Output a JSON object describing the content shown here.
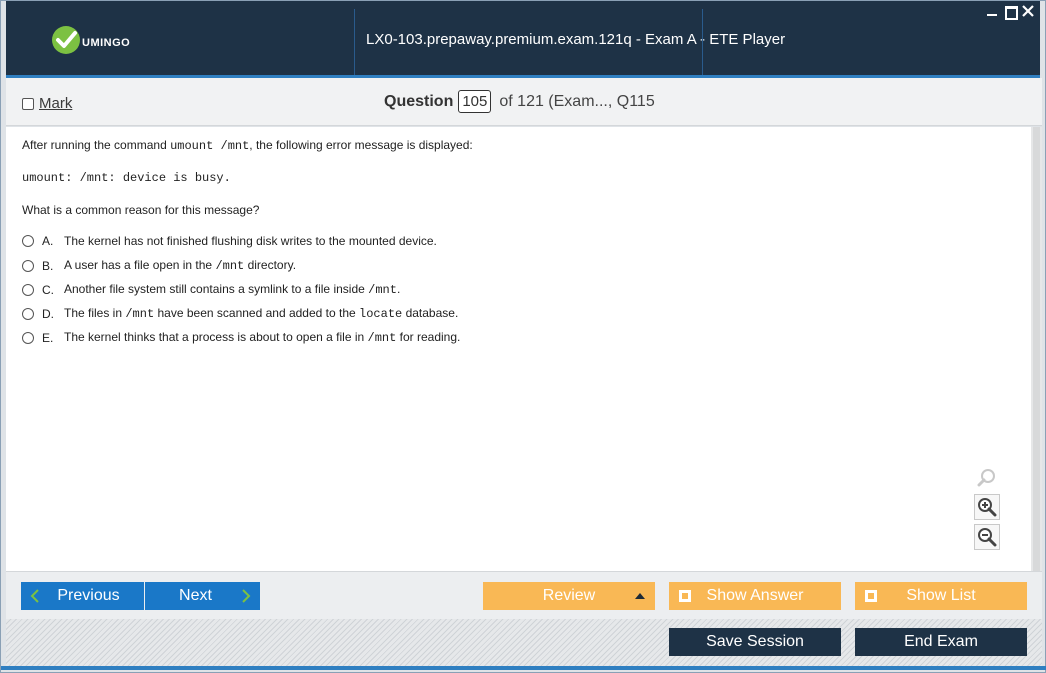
{
  "titlebar": {
    "logo_text": "UMINGO",
    "title": "LX0-103.prepaway.premium.exam.121q - Exam A - ETE Player"
  },
  "question_bar": {
    "mark_label": "Mark",
    "question_label": "Question",
    "question_number": "105",
    "of_text": "of 121 (Exam..., Q115"
  },
  "question": {
    "intro_prefix": "After running the command ",
    "intro_command": "umount /mnt",
    "intro_suffix": ", the following error message is displayed:",
    "error_message": "umount: /mnt: device is busy.",
    "prompt": "What is a common reason for this message?",
    "answers": [
      {
        "letter": "A.",
        "parts": [
          "The kernel has not finished flushing disk writes to the mounted device."
        ]
      },
      {
        "letter": "B.",
        "parts": [
          "A user has a file open in the ",
          "/mnt",
          " directory."
        ]
      },
      {
        "letter": "C.",
        "parts": [
          "Another file system still contains a symlink to a file inside ",
          "/mnt",
          "."
        ]
      },
      {
        "letter": "D.",
        "parts": [
          "The files in ",
          "/mnt",
          " have been scanned and added to the ",
          "locate",
          " database."
        ]
      },
      {
        "letter": "E.",
        "parts": [
          "The kernel thinks that a process is about to open a file in ",
          "/mnt",
          " for reading."
        ]
      }
    ]
  },
  "zoom": {
    "icons": [
      "zoom-reset-icon",
      "zoom-in-icon",
      "zoom-out-icon"
    ]
  },
  "nav": {
    "previous": "Previous",
    "next": "Next",
    "review": "Review",
    "show_answer": "Show Answer",
    "show_list": "Show List",
    "save_session": "Save Session",
    "end_exam": "End Exam"
  },
  "colors": {
    "titlebar": "#1e3246",
    "accent_blue": "#1a78c8",
    "accent_orange": "#f9b855",
    "logo_green": "#7cc142"
  }
}
